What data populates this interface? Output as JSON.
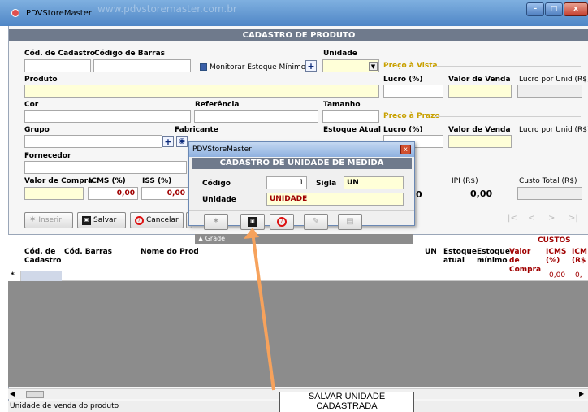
{
  "window": {
    "title": "PDVStoreMaster",
    "watermark": "www.pdvstoremaster.com.br"
  },
  "form": {
    "header": "CADASTRO DE PRODUTO",
    "labels": {
      "cod_cadastro": "Cód. de Cadastro",
      "cod_barras": "Código de Barras",
      "monitorar": "Monitorar Estoque Mínimo",
      "unidade": "Unidade",
      "produto": "Produto",
      "cor": "Cor",
      "referencia": "Referência",
      "tamanho": "Tamanho",
      "grupo": "Grupo",
      "fabricante": "Fabricante",
      "estoque_atual": "Estoque Atual",
      "fornecedor": "Fornecedor",
      "valor_compra": "Valor de Compra",
      "icms_pct": "ICMS (%)",
      "iss_pct": "ISS (%)",
      "ipi_rs": "IPI (R$)",
      "custo_total": "Custo Total (R$)",
      "preco_vista": "Preço à Vista",
      "preco_prazo": "Preço à Prazo",
      "lucro_pct": "Lucro (%)",
      "valor_venda": "Valor de Venda",
      "lucro_unid": "Lucro por Unid (R$)"
    },
    "values": {
      "icms": "0,00",
      "iss": "0,00",
      "ipi": "0,00",
      "partial": "0"
    }
  },
  "toolbar": {
    "inserir": "Inserir",
    "salvar": "Salvar",
    "cancelar": "Cancelar"
  },
  "grid": {
    "columns": [
      "Cód. de Cadastro",
      "Cód. Barras",
      "Nome do Prod",
      "UN",
      "Estoque atual",
      "Estoque mínimo",
      "Valor de Compra",
      "ICMS (%)",
      "ICM (R$"
    ],
    "group": "CUSTOS",
    "row_marker": "*",
    "row_icms": "0,00",
    "row_icms_rs": "0,"
  },
  "dialog": {
    "title": "PDVStoreMaster",
    "header": "CADASTRO DE UNIDADE DE MEDIDA",
    "codigo_label": "Código",
    "codigo_value": "1",
    "sigla_label": "Sigla",
    "sigla_value": "UN",
    "unidade_label": "Unidade",
    "unidade_value": "UNIDADE",
    "grade_label": "Grade"
  },
  "callout": {
    "text": "SALVAR UNIDADE CADASTRADA"
  },
  "status": {
    "text": "Unidade de venda do produto"
  },
  "colors": {
    "accent_bar": "#6f7a8c",
    "required": "#ffffd8",
    "callout_arrow": "#f6a25c",
    "cost_red": "#a00000",
    "price_gold": "#c8a000"
  }
}
